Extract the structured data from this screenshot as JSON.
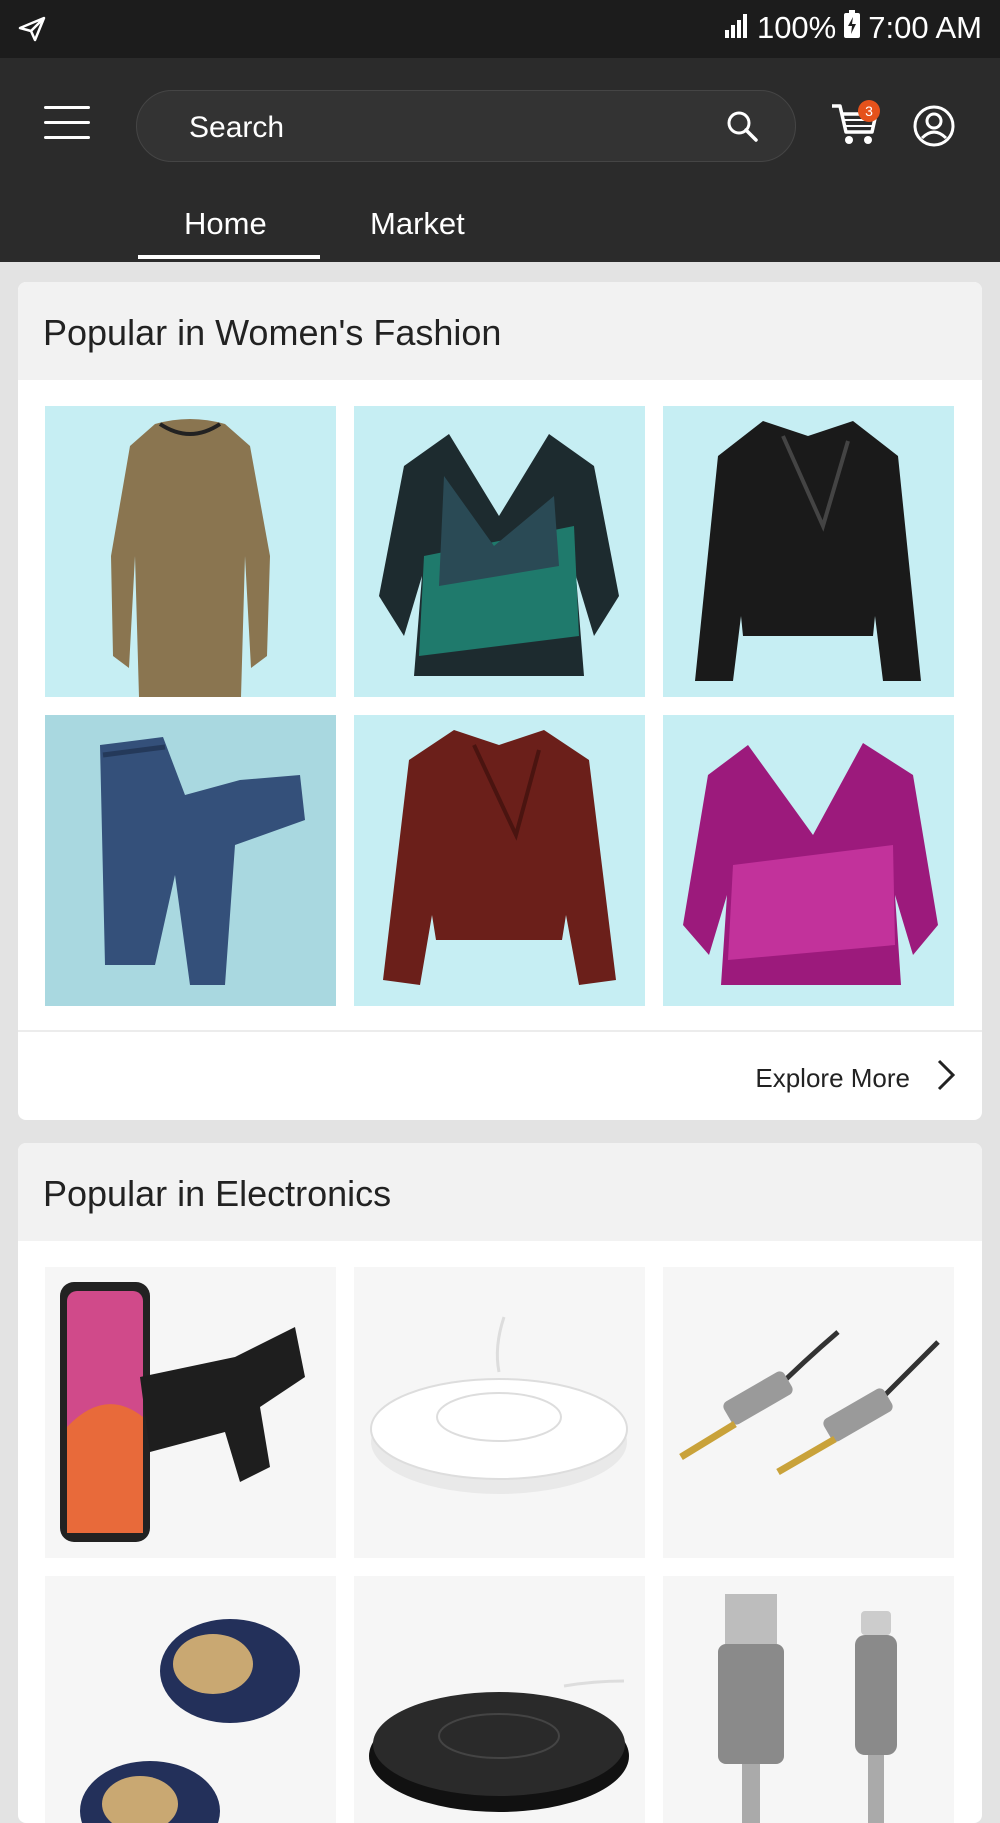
{
  "status_bar": {
    "battery": "100%",
    "time": "7:00 AM"
  },
  "search": {
    "placeholder": "Search"
  },
  "cart": {
    "count": "3"
  },
  "tabs": [
    {
      "label": "Home"
    },
    {
      "label": "Market"
    }
  ],
  "sections": [
    {
      "title": "Popular in Women's Fashion",
      "footer_link": "Explore More",
      "items": [
        "tan-lace-dress",
        "teal-velvet-blouse",
        "black-leather-jacket",
        "blue-jeans",
        "burgundy-moto-jacket",
        "magenta-velvet-blouse"
      ]
    },
    {
      "title": "Popular in Electronics",
      "items": [
        "phone-car-mount",
        "white-wireless-charger",
        "aux-audio-cable",
        "wireless-earbuds",
        "black-wireless-charger",
        "usb-lightning-cable"
      ]
    }
  ],
  "colors": {
    "status_bar": "#1c1c1c",
    "app_bar": "#2b2b2b",
    "badge": "#e5521b",
    "fashion_tile_bg": "#c6eef3",
    "page_bg": "#e3e3e3"
  }
}
